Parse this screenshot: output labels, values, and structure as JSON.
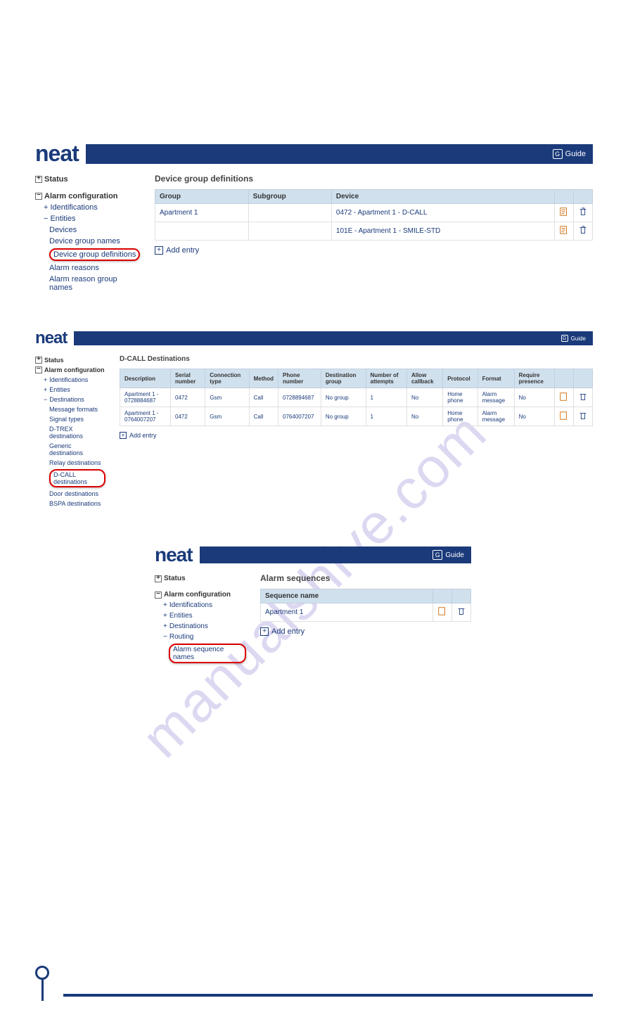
{
  "watermark": "manualshive.com",
  "logo": "neat",
  "guide_label": "Guide",
  "add_entry_label": "Add entry",
  "section1": {
    "nav": {
      "status": "Status",
      "alarm_config": "Alarm configuration",
      "identifications": "Identifications",
      "entities": "Entities",
      "devices": "Devices",
      "device_group_names": "Device group names",
      "device_group_defs": "Device group definitions",
      "alarm_reasons": "Alarm reasons",
      "alarm_reason_groups": "Alarm reason group names"
    },
    "title": "Device group definitions",
    "headers": {
      "group": "Group",
      "subgroup": "Subgroup",
      "device": "Device"
    },
    "rows": [
      {
        "group": "Apartment 1",
        "subgroup": "",
        "device": "0472 - Apartment 1 - D-CALL"
      },
      {
        "group": "",
        "subgroup": "",
        "device": "101E - Apartment 1 - SMILE-STD"
      }
    ]
  },
  "section2": {
    "nav": {
      "status": "Status",
      "alarm_config": "Alarm configuration",
      "identifications": "Identifications",
      "entities": "Entities",
      "destinations": "Destinations",
      "message_formats": "Message formats",
      "signal_types": "Signal types",
      "dtrex": "D-TREX destinations",
      "generic": "Generic destinations",
      "relay": "Relay destinations",
      "dcall": "D-CALL destinations",
      "door": "Door destinations",
      "bspa": "BSPA destinations"
    },
    "title": "D-CALL Destinations",
    "headers": {
      "description": "Description",
      "serial": "Serial number",
      "conn_type": "Connection type",
      "method": "Method",
      "phone": "Phone number",
      "dest_group": "Destination group",
      "attempts": "Number of attempts",
      "allow_cb": "Allow callback",
      "protocol": "Protocol",
      "format": "Format",
      "require": "Require presence"
    },
    "rows": [
      {
        "description": "Apartment 1 - 0728884687",
        "serial": "0472",
        "conn_type": "Gsm",
        "method": "Call",
        "phone": "0728894687",
        "dest_group": "No group",
        "attempts": "1",
        "allow_cb": "No",
        "protocol": "Home phone",
        "format": "Alarm message",
        "require": "No"
      },
      {
        "description": "Apartment 1 - 0764007207",
        "serial": "0472",
        "conn_type": "Gsm",
        "method": "Call",
        "phone": "0764007207",
        "dest_group": "No group",
        "attempts": "1",
        "allow_cb": "No",
        "protocol": "Home phone",
        "format": "Alarm message",
        "require": "No"
      }
    ]
  },
  "section3": {
    "nav": {
      "status": "Status",
      "alarm_config": "Alarm configuration",
      "identifications": "Identifications",
      "entities": "Entities",
      "destinations": "Destinations",
      "routing": "Routing",
      "alarm_seq": "Alarm sequence names"
    },
    "title": "Alarm sequences",
    "headers": {
      "seq_name": "Sequence name"
    },
    "rows": [
      {
        "seq_name": "Apartment 1"
      }
    ]
  }
}
